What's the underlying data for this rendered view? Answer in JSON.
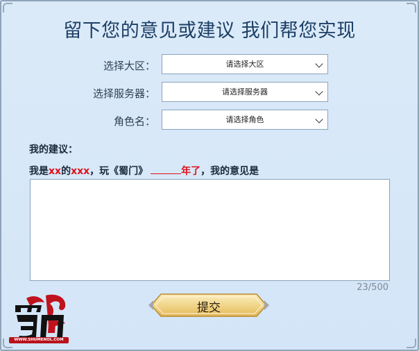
{
  "title": "留下您的意见或建议 我们帮您实现",
  "form": {
    "region": {
      "label": "选择大区：",
      "value": "请选择大区"
    },
    "server": {
      "label": "选择服务器：",
      "value": "请选择服务器"
    },
    "role": {
      "label": "角色名：",
      "value": "请选择角色"
    }
  },
  "suggestion": {
    "label": "我的建议：",
    "line_prefix": "我是",
    "xx": "xx",
    "de": "的",
    "xxx": "xxx",
    "play": "，玩《蜀门》",
    "year": "年了",
    "suffix": "，我的意见是",
    "counter": "23/500"
  },
  "submit_label": "提交",
  "logo": {
    "text": "蜀門",
    "caption": "WWW.SHUMENOL.COM"
  },
  "colors": {
    "accent_red": "#e0101a",
    "title_blue": "#1d3f66",
    "button_gold": "#f1d68a"
  }
}
